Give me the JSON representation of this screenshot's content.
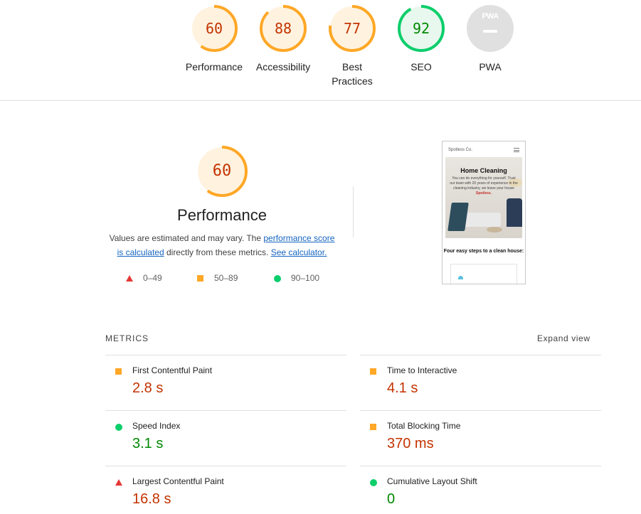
{
  "colors": {
    "fail": "#c33300",
    "average": "#c33300",
    "pass": "#008800",
    "ring_orange": "#ffa726",
    "ring_green": "#0cce6b",
    "tri_red": "#e53935",
    "pwa_grey": "#e0e0e0"
  },
  "gauges": [
    {
      "value": "60",
      "label": "Performance",
      "score": 0.6,
      "rating": "average",
      "icon": "performance-gauge"
    },
    {
      "value": "88",
      "label": "Accessibility",
      "score": 0.88,
      "rating": "average",
      "icon": "accessibility-gauge"
    },
    {
      "value": "77",
      "label": "Best",
      "label2": "Practices",
      "score": 0.77,
      "rating": "average",
      "icon": "best-practices-gauge"
    },
    {
      "value": "92",
      "label": "SEO",
      "score": 0.92,
      "rating": "pass",
      "icon": "seo-gauge"
    },
    {
      "value": "",
      "label": "PWA",
      "badge": "PWA",
      "icon": "pwa-badge"
    }
  ],
  "performance": {
    "score_text": "60",
    "score": 0.6,
    "title": "Performance",
    "desc_prefix": "Values are estimated and may vary. The ",
    "desc_link1_a": "performance score",
    "desc_link1_b": "is calculated",
    "desc_middle": " directly from these metrics. ",
    "desc_link2": "See calculator."
  },
  "legend": [
    {
      "range": "0–49",
      "icon": "triangle-red"
    },
    {
      "range": "50–89",
      "icon": "square-orange"
    },
    {
      "range": "90–100",
      "icon": "circle-green"
    }
  ],
  "thumbnail": {
    "brand": "Spotless Co.",
    "hero_title": "Home Cleaning",
    "hero_text": "You can do everything for yourself. Trust our team with 20 years of experience in the cleaning industry, we leave your house",
    "hero_emph": "Spotless.",
    "subheading": "Four easy steps to a clean house:"
  },
  "metrics": {
    "heading": "METRICS",
    "expand": "Expand view",
    "items": [
      {
        "name": "First Contentful Paint",
        "value": "2.8 s",
        "rating": "average"
      },
      {
        "name": "Time to Interactive",
        "value": "4.1 s",
        "rating": "average"
      },
      {
        "name": "Speed Index",
        "value": "3.1 s",
        "rating": "pass"
      },
      {
        "name": "Total Blocking Time",
        "value": "370 ms",
        "rating": "average"
      },
      {
        "name": "Largest Contentful Paint",
        "value": "16.8 s",
        "rating": "fail"
      },
      {
        "name": "Cumulative Layout Shift",
        "value": "0",
        "rating": "pass"
      }
    ]
  }
}
